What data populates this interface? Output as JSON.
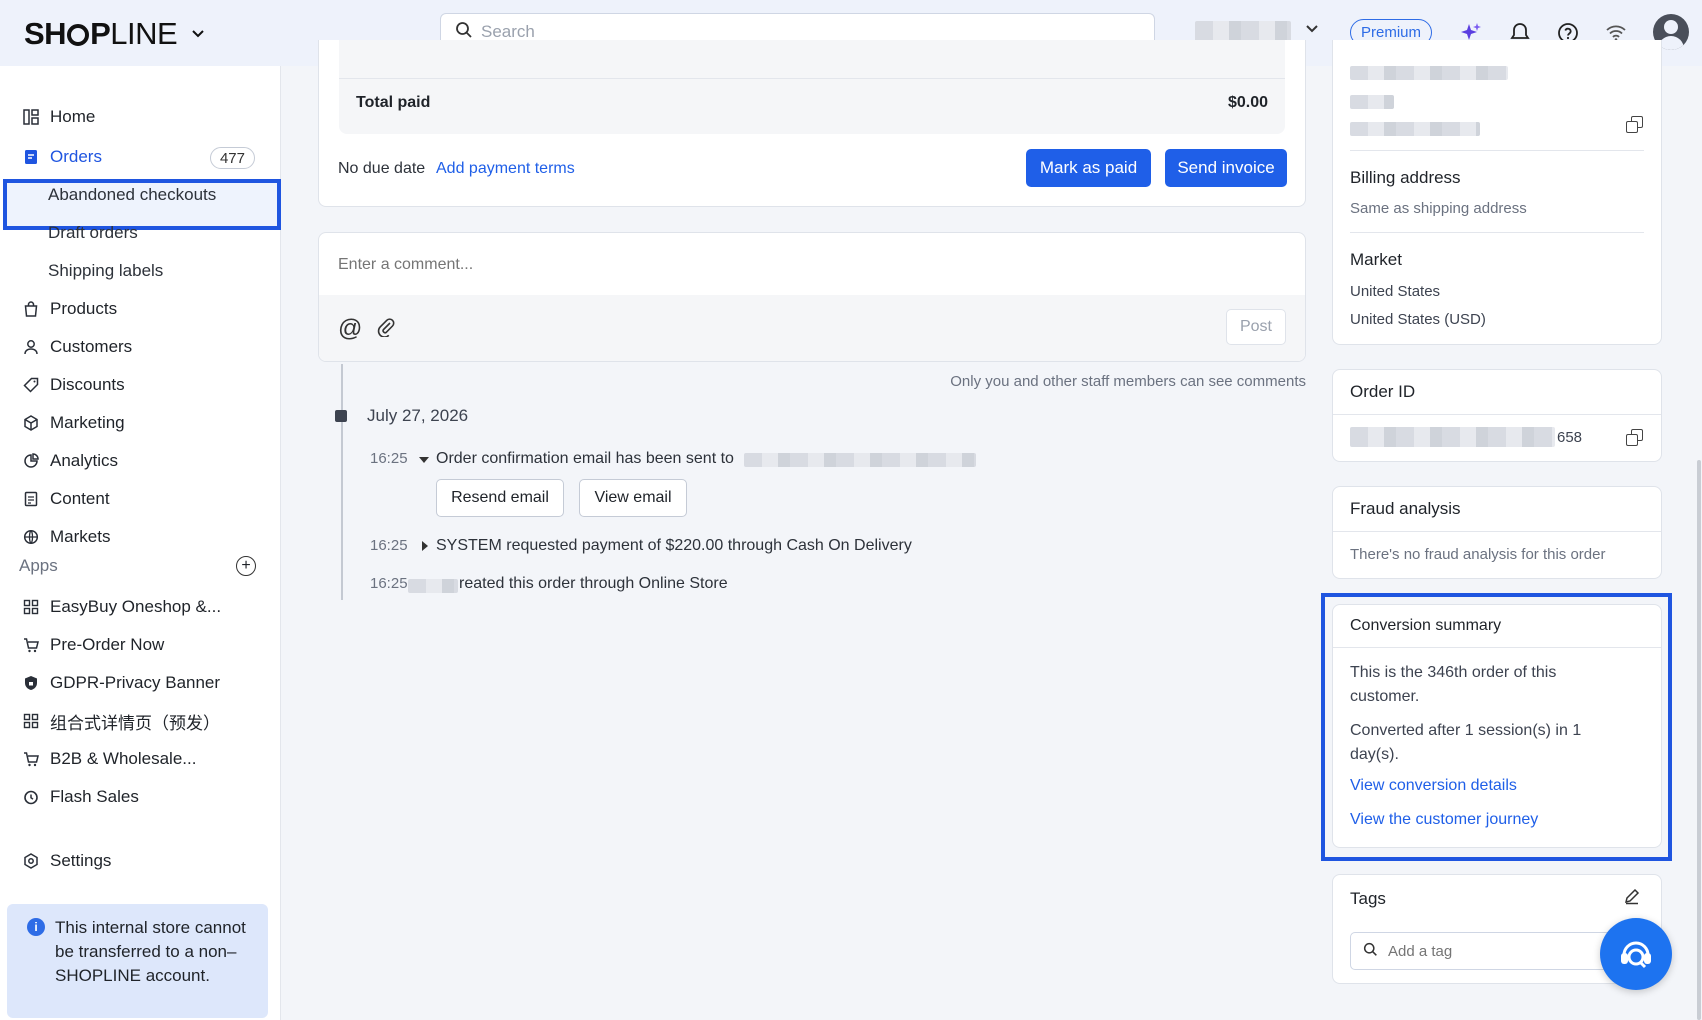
{
  "topbar": {
    "logo_text": "SHOPLINE",
    "search_placeholder": "Search",
    "premium_label": "Premium"
  },
  "sidebar": {
    "items": [
      {
        "label": "Home",
        "icon": "home-icon"
      },
      {
        "label": "Orders",
        "icon": "orders-icon",
        "badge": "477"
      },
      {
        "label": "Abandoned checkouts"
      },
      {
        "label": "Draft orders"
      },
      {
        "label": "Shipping labels"
      },
      {
        "label": "Products",
        "icon": "bag-icon"
      },
      {
        "label": "Customers",
        "icon": "user-icon"
      },
      {
        "label": "Discounts",
        "icon": "tag-icon"
      },
      {
        "label": "Marketing",
        "icon": "cube-icon"
      },
      {
        "label": "Analytics",
        "icon": "chart-icon"
      },
      {
        "label": "Content",
        "icon": "document-icon"
      },
      {
        "label": "Markets",
        "icon": "globe-icon"
      }
    ],
    "apps_heading": "Apps",
    "apps": [
      {
        "label": "EasyBuy Oneshop &...",
        "icon": "grid-icon"
      },
      {
        "label": "Pre-Order Now",
        "icon": "cart-icon"
      },
      {
        "label": "GDPR-Privacy Banner",
        "icon": "shield-icon"
      },
      {
        "label": "组合式详情页（预发）",
        "icon": "grid-icon"
      },
      {
        "label": "B2B & Wholesale...",
        "icon": "cart-icon"
      },
      {
        "label": "Flash Sales",
        "icon": "clock-icon"
      }
    ],
    "settings_label": "Settings",
    "notice": "This internal store cannot be transferred to a non–SHOPLINE account."
  },
  "payment": {
    "total_paid_label": "Total paid",
    "total_paid_value": "$0.00",
    "due_text": "No due date",
    "add_terms_link": "Add payment terms",
    "mark_paid_button": "Mark as paid",
    "send_invoice_button": "Send invoice"
  },
  "comment": {
    "placeholder": "Enter a comment...",
    "post_button": "Post",
    "visibility_note": "Only you and other staff members can see comments"
  },
  "timeline": {
    "date": "July 27, 2026",
    "events": [
      {
        "time": "16:25",
        "text": "Order confirmation email has been sent to"
      },
      {
        "time": "16:25",
        "text": "SYSTEM requested payment of $220.00 through Cash On Delivery"
      },
      {
        "time": "16:25",
        "text": "reated this order through Online Store"
      }
    ],
    "resend_button": "Resend email",
    "view_button": "View email"
  },
  "right_panel": {
    "billing_title": "Billing address",
    "billing_value": "Same as shipping address",
    "market_title": "Market",
    "market_lines": [
      "United States",
      "United States (USD)"
    ],
    "order_id_title": "Order ID",
    "order_id_suffix": "658",
    "fraud_title": "Fraud analysis",
    "fraud_text": "There's no fraud analysis for this order",
    "conversion_title": "Conversion summary",
    "conversion_line1": "This is the 346th order of this customer.",
    "conversion_line2": "Converted after 1 session(s) in 1 day(s).",
    "conversion_link1": "View conversion details",
    "conversion_link2": "View the customer journey",
    "tags_title": "Tags",
    "tags_placeholder": "Add a tag"
  },
  "colors": {
    "accent": "#1f5fe8",
    "highlight_border": "#1f55e0",
    "topbar_bg": "#eef2fb"
  }
}
